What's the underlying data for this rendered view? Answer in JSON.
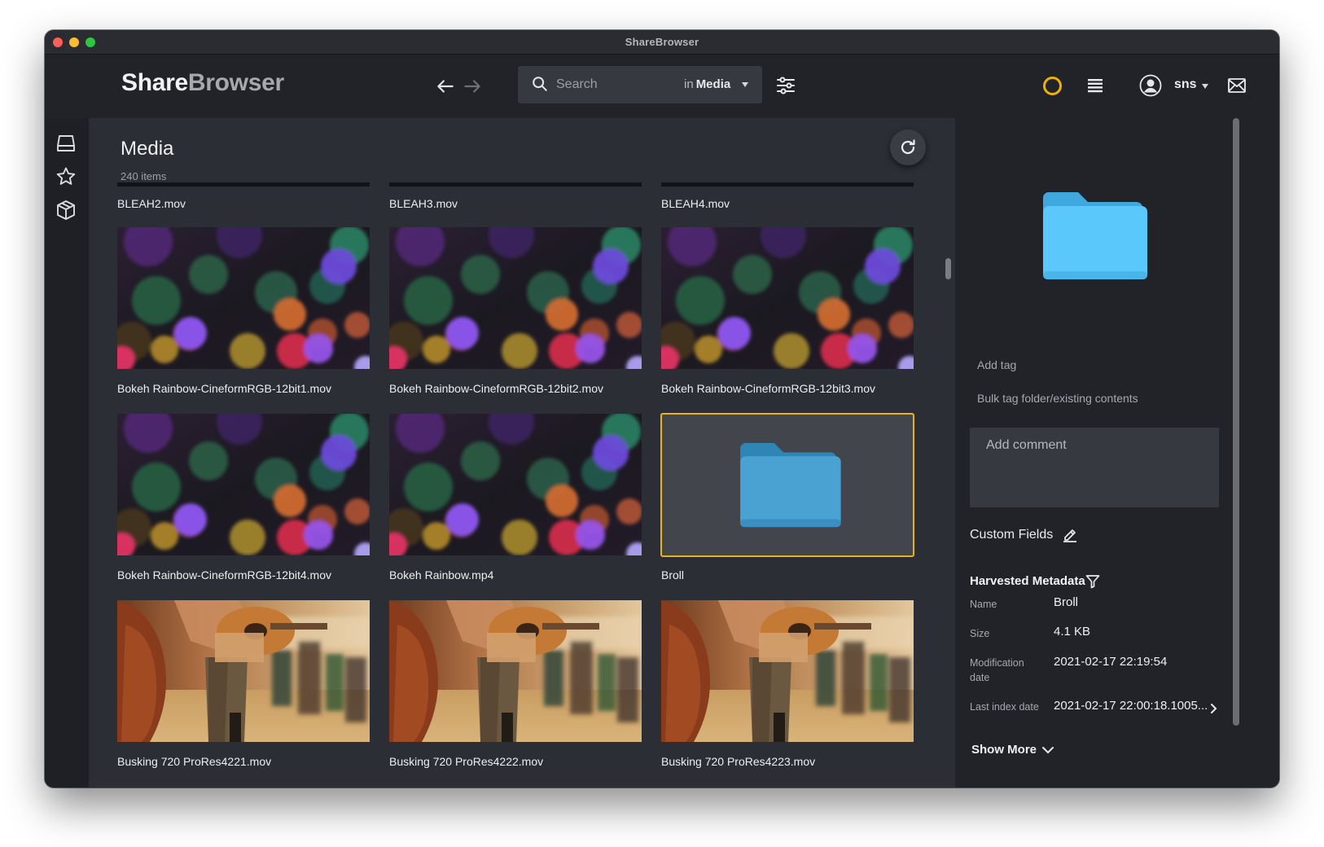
{
  "window": {
    "title": "ShareBrowser"
  },
  "header": {
    "logo_primary": "Share",
    "logo_secondary": "Browser",
    "search_placeholder": "Search",
    "search_scope_prefix": "in",
    "search_scope": "Media",
    "username": "sns",
    "status_ring_color": "#f0b000"
  },
  "sidebar": {
    "items": [
      {
        "icon": "drive-icon"
      },
      {
        "icon": "star-icon"
      },
      {
        "icon": "package-icon"
      }
    ]
  },
  "main": {
    "title": "Media",
    "count": "240 items",
    "top_row": [
      "BLEAH2.mov",
      "BLEAH3.mov",
      "BLEAH4.mov"
    ],
    "items": [
      {
        "name": "Bokeh Rainbow-CineformRGB-12bit1.mov",
        "kind": "bokeh"
      },
      {
        "name": "Bokeh Rainbow-CineformRGB-12bit2.mov",
        "kind": "bokeh"
      },
      {
        "name": "Bokeh Rainbow-CineformRGB-12bit3.mov",
        "kind": "bokeh"
      },
      {
        "name": "Bokeh Rainbow-CineformRGB-12bit4.mov",
        "kind": "bokeh"
      },
      {
        "name": "Bokeh Rainbow.mp4",
        "kind": "bokeh"
      },
      {
        "name": "Broll",
        "kind": "folder",
        "selected": true
      },
      {
        "name": "Busking 720 ProRes4221.mov",
        "kind": "busking"
      },
      {
        "name": "Busking 720 ProRes4222.mov",
        "kind": "busking"
      },
      {
        "name": "Busking 720 ProRes4223.mov",
        "kind": "busking"
      }
    ]
  },
  "detail": {
    "add_tag": "Add tag",
    "bulk_tag": "Bulk tag folder/existing contents",
    "comment_placeholder": "Add comment",
    "custom_fields": "Custom Fields",
    "harvested_metadata": "Harvested Metadata",
    "metadata": [
      {
        "key": "Name",
        "value": "Broll"
      },
      {
        "key": "Size",
        "value": "4.1 KB"
      },
      {
        "key": "Modification date",
        "value": "2021-02-17 22:19:54"
      },
      {
        "key": "Last index date",
        "value": "2021-02-17 22:00:18.1005..."
      }
    ],
    "show_more": "Show More"
  },
  "colors": {
    "accent_selected": "#e7b21e",
    "folder": "#4db8ea",
    "folder_muted": "#3b9bd0"
  }
}
